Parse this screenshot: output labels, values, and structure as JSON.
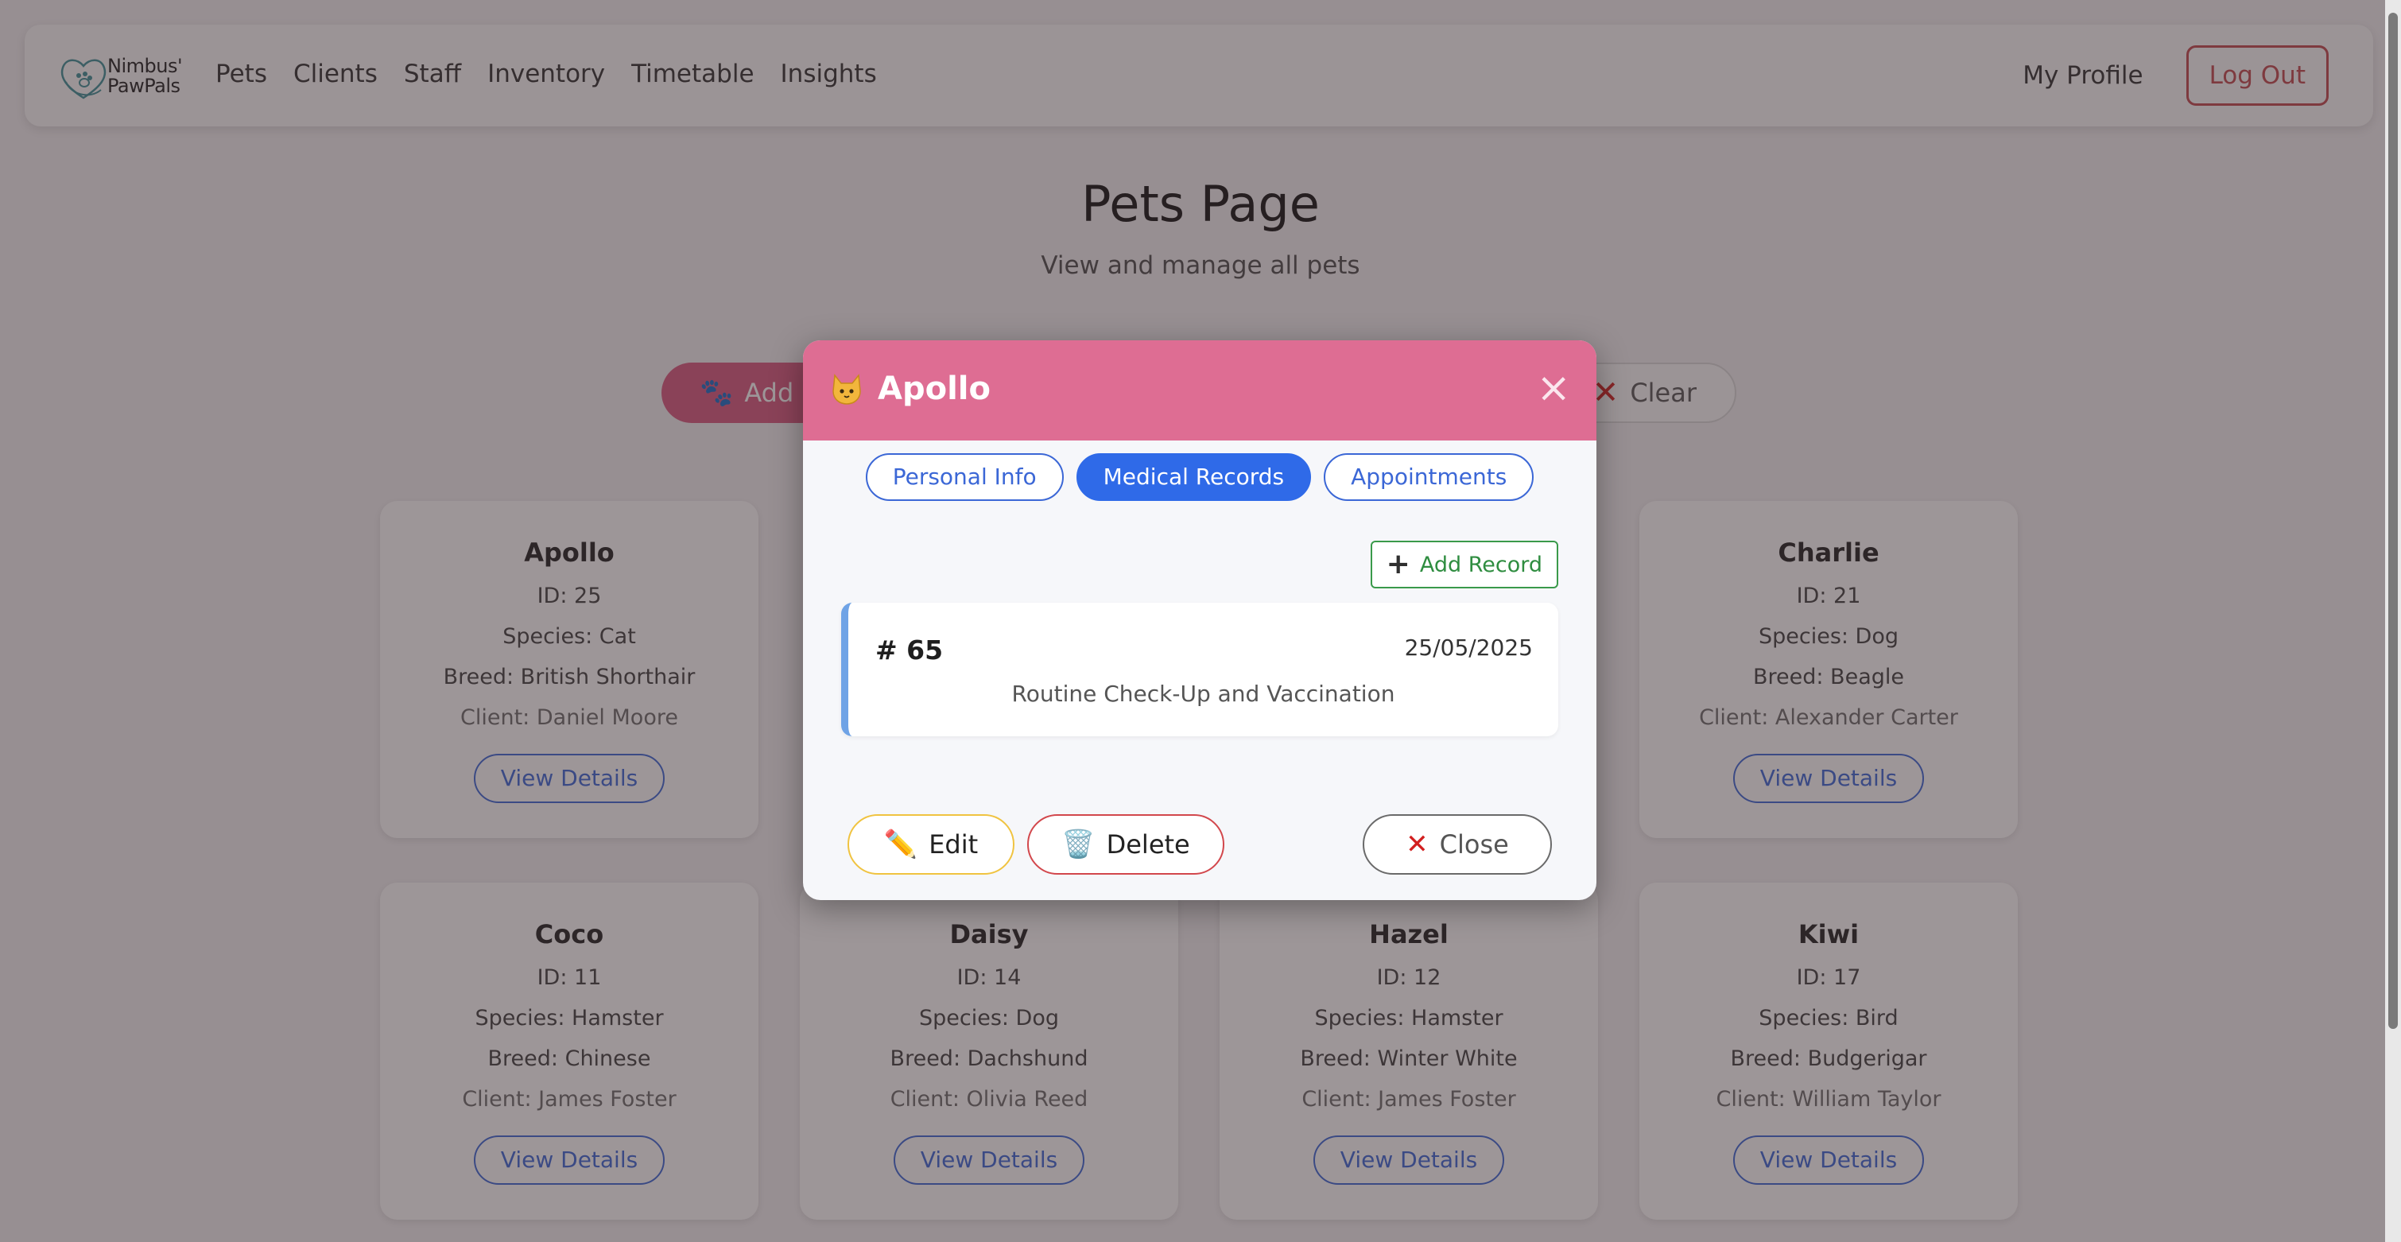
{
  "brand": {
    "line1": "Nimbus'",
    "line2": "PawPals"
  },
  "nav": {
    "links": [
      "Pets",
      "Clients",
      "Staff",
      "Inventory",
      "Timetable",
      "Insights"
    ],
    "profile": "My Profile",
    "logout": "Log Out"
  },
  "header": {
    "title": "Pets Page",
    "subtitle": "View and manage all pets"
  },
  "actions": {
    "add_pet_label": "Add P",
    "clear_label": "Clear"
  },
  "cards": [
    {
      "name": "Apollo",
      "id": "ID: 25",
      "species": "Species: Cat",
      "breed": "Breed: British Shorthair",
      "client": "Client: Daniel Moore",
      "button": "View Details"
    },
    {
      "name": "Charlie",
      "id": "ID: 21",
      "species": "Species: Dog",
      "breed": "Breed: Beagle",
      "client": "Client: Alexander Carter",
      "button": "View Details"
    },
    {
      "name": "Coco",
      "id": "ID: 11",
      "species": "Species: Hamster",
      "breed": "Breed: Chinese",
      "client": "Client: James Foster",
      "button": "View Details"
    },
    {
      "name": "Daisy",
      "id": "ID: 14",
      "species": "Species: Dog",
      "breed": "Breed: Dachshund",
      "client": "Client: Olivia Reed",
      "button": "View Details"
    },
    {
      "name": "Hazel",
      "id": "ID: 12",
      "species": "Species: Hamster",
      "breed": "Breed: Winter White",
      "client": "Client: James Foster",
      "button": "View Details"
    },
    {
      "name": "Kiwi",
      "id": "ID: 17",
      "species": "Species: Bird",
      "breed": "Breed: Budgerigar",
      "client": "Client: William Taylor",
      "button": "View Details"
    }
  ],
  "modal": {
    "title": "Apollo",
    "tabs": [
      "Personal Info",
      "Medical Records",
      "Appointments"
    ],
    "active_tab": "Medical Records",
    "add_record": "Add Record",
    "record": {
      "id": "# 65",
      "date": "25/05/2025",
      "description": "Routine Check-Up and Vaccination"
    },
    "buttons": {
      "edit": "Edit",
      "delete": "Delete",
      "close": "Close"
    }
  },
  "colors": {
    "accent_pink": "#de6d93",
    "primary_blue": "#2f6ae8",
    "danger_red": "#c0474c",
    "success_green": "#2f8d40"
  },
  "icons": {
    "title_icon": "cat-face-icon",
    "add_pet_icon": "paw-icon",
    "clear_icon": "x-icon",
    "edit_icon": "pencil-icon",
    "delete_icon": "trash-icon",
    "close_icon": "x-icon"
  }
}
